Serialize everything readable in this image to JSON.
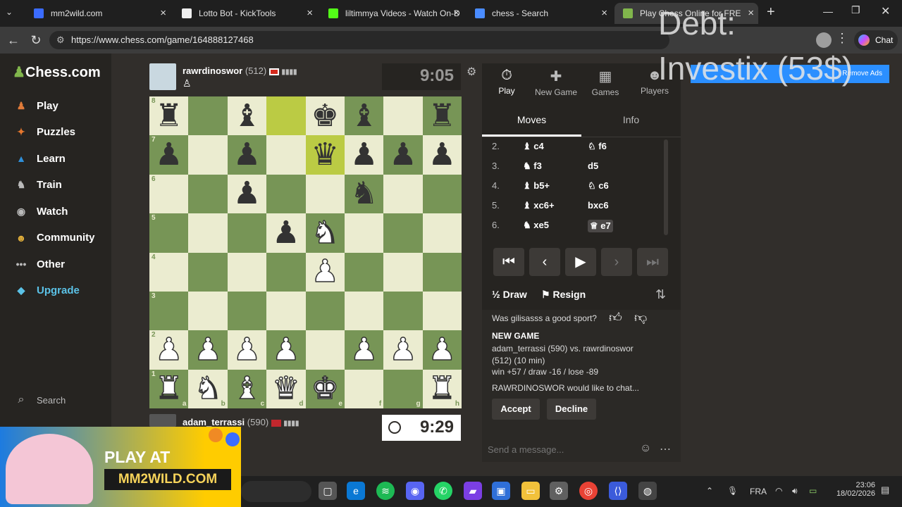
{
  "tabs": [
    {
      "label": "mm2wild.com",
      "color": "#3b6cff"
    },
    {
      "label": "Lotto Bot - KickTools",
      "color": "#eeeeee"
    },
    {
      "label": "liltimmya Videos - Watch On-D",
      "color": "#53fc18"
    },
    {
      "label": "chess - Search",
      "color": "#4a8cff"
    },
    {
      "label": "Play Chess Online for FRE",
      "color": "#81b64c"
    }
  ],
  "url": "https://www.chess.com/game/164888127468",
  "chat_label": "Chat",
  "overlay": {
    "line1": "Debt:",
    "line2": "Investix (53$)"
  },
  "remove_ads": "Remove Ads",
  "sidebar": {
    "logo": "Chess.com",
    "items": [
      {
        "label": "Play",
        "icon": "play-icon",
        "color": "#e07b39"
      },
      {
        "label": "Puzzles",
        "icon": "puzzle-icon",
        "color": "#e6772e"
      },
      {
        "label": "Learn",
        "icon": "learn-icon",
        "color": "#2f8fd9"
      },
      {
        "label": "Train",
        "icon": "train-icon",
        "color": "#bababa"
      },
      {
        "label": "Watch",
        "icon": "watch-icon",
        "color": "#bababa"
      },
      {
        "label": "Community",
        "icon": "community-icon",
        "color": "#e0ae3a"
      },
      {
        "label": "Other",
        "icon": "more-icon",
        "color": "#bababa"
      },
      {
        "label": "Upgrade",
        "icon": "diamond-icon",
        "color": "#5bc2e7"
      }
    ],
    "search": "Search"
  },
  "top_player": {
    "name": "rawrdinoswor",
    "rating": "(512)",
    "clock": "9:05"
  },
  "bottom_player": {
    "name": "adam_terrassi",
    "rating": "(590)",
    "clock": "9:29"
  },
  "board": [
    [
      "br",
      "",
      "bb",
      "",
      "bk",
      "bb",
      "",
      "br"
    ],
    [
      "bp",
      "",
      "bp",
      "",
      "bq",
      "bp",
      "bp",
      "bp"
    ],
    [
      "",
      "",
      "bp",
      "",
      "",
      "bn",
      "",
      ""
    ],
    [
      "",
      "",
      "",
      "bp",
      "wn",
      "",
      "",
      ""
    ],
    [
      "",
      "",
      "",
      "",
      "wp",
      "",
      "",
      ""
    ],
    [
      "",
      "",
      "",
      "",
      "",
      "",
      "",
      ""
    ],
    [
      "wp",
      "wp",
      "wp",
      "wp",
      "",
      "wp",
      "wp",
      "wp"
    ],
    [
      "wr",
      "wn",
      "wb",
      "wq",
      "wk",
      "",
      "",
      "wr"
    ]
  ],
  "ranks": [
    "8",
    "7",
    "6",
    "5",
    "4",
    "3",
    "2",
    "1"
  ],
  "files": [
    "a",
    "b",
    "c",
    "d",
    "e",
    "f",
    "g",
    "h"
  ],
  "panel": {
    "tabs": [
      "Play",
      "New Game",
      "Games",
      "Players"
    ],
    "move_tabs": [
      "Moves",
      "Info"
    ],
    "moves": [
      {
        "n": "2.",
        "w": "♝ c4",
        "b": "♘ f6"
      },
      {
        "n": "3.",
        "w": "♞ f3",
        "b": "d5"
      },
      {
        "n": "4.",
        "w": "♝ b5+",
        "b": "♘ c6"
      },
      {
        "n": "5.",
        "w": "♝ xc6+",
        "b": "bxc6"
      },
      {
        "n": "6.",
        "w": "♞ xe5",
        "b": "♕ e7"
      }
    ],
    "draw": "Draw",
    "resign": "Resign",
    "sport_q": "Was gilisasss a good sport?",
    "new_game": "NEW GAME",
    "matchup": "adam_terrassi (590) vs. rawrdinoswor (512) (10 min)",
    "stakes": "win +57 / draw -16 / lose -89",
    "chat_req": "RAWRDINOSWOR would like to chat...",
    "accept": "Accept",
    "decline": "Decline",
    "msg_placeholder": "Send a message..."
  },
  "promo": {
    "line1": "PLAY AT",
    "line2": "MM2WILD.COM"
  },
  "taskbar": {
    "lang": "FRA",
    "time": "23:06",
    "date": "18/02/2026"
  }
}
